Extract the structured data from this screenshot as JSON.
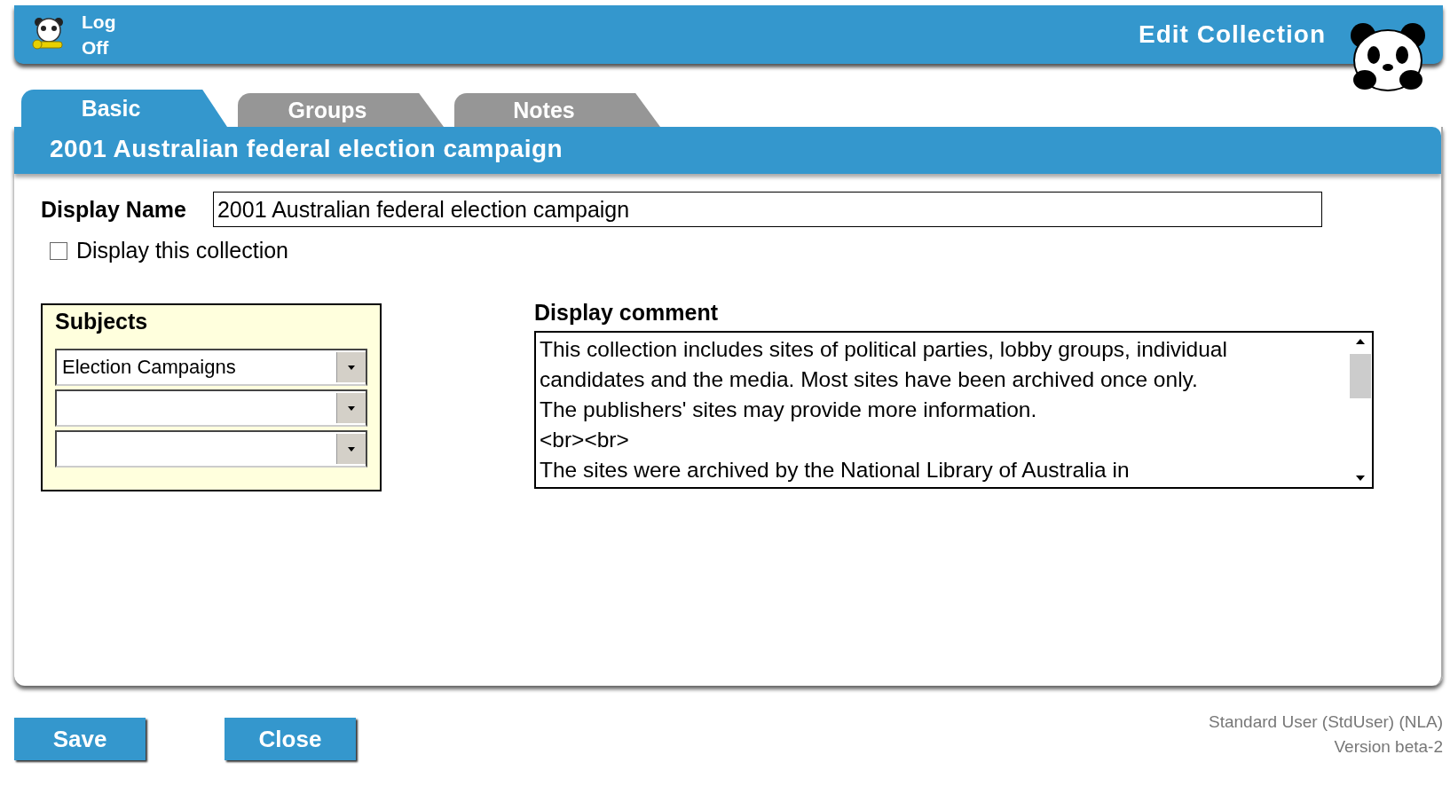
{
  "header": {
    "logoff_label": "Log\nOff",
    "title": "Edit Collection"
  },
  "tabs": [
    {
      "label": "Basic",
      "selected": true
    },
    {
      "label": "Groups",
      "selected": false
    },
    {
      "label": "Notes",
      "selected": false
    }
  ],
  "record_title": "2001 Australian federal election campaign",
  "display_name": {
    "label": "Display Name",
    "value": "2001 Australian federal election campaign"
  },
  "display_checkbox": {
    "label": "Display this collection",
    "checked": false
  },
  "subjects": {
    "title": "Subjects",
    "dropdowns": [
      {
        "kind": "dropdown",
        "value": "Election Campaigns"
      },
      {
        "kind": "dropdown"
      },
      {
        "kind": "dropdown"
      }
    ]
  },
  "display_comment": {
    "label": "Display comment",
    "lines": [
      "This collection includes sites of political parties, lobby groups, individual",
      "candidates and the media. Most sites have been archived once only.",
      "The publishers' sites may provide more information.",
      "<br><br>",
      "The sites were archived by the National Library of Australia in"
    ]
  },
  "buttons": [
    "Save",
    "Close"
  ],
  "footer": {
    "user": "Standard User (StdUser) (NLA)",
    "version": "Version beta-2"
  }
}
